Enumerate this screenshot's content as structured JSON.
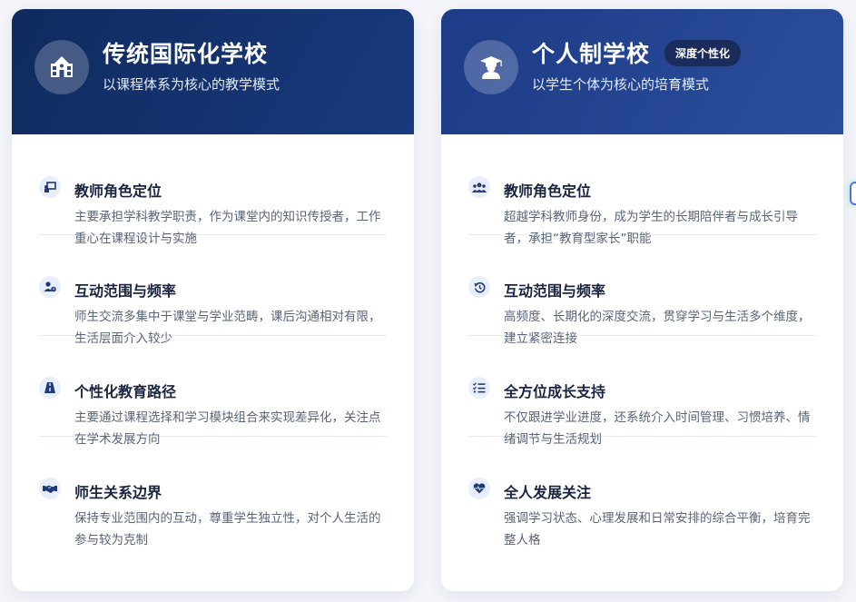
{
  "cards": [
    {
      "title": "传统国际化学校",
      "subtitle": "以课程体系为核心的教学模式",
      "icon": "school-icon",
      "items": [
        {
          "title": "教师角色定位",
          "desc": "主要承担学科教学职责，作为课堂内的知识传授者，工作重心在课程设计与实施",
          "icon": "chalkboard-teacher-icon"
        },
        {
          "title": "互动范围与频率",
          "desc": "师生交流多集中于课堂与学业范畴，课后沟通相对有限，生活层面介入较少",
          "icon": "user-clock-icon"
        },
        {
          "title": "个性化教育路径",
          "desc": "主要通过课程选择和学习模块组合来实现差异化，关注点在学术发展方向",
          "icon": "road-icon"
        },
        {
          "title": "师生关系边界",
          "desc": "保持专业范围内的互动，尊重学生独立性，对个人生活的参与较为克制",
          "icon": "handshake-icon"
        }
      ]
    },
    {
      "title": "个人制学校",
      "badge": "深度个性化",
      "subtitle": "以学生个体为核心的培育模式",
      "icon": "graduate-icon",
      "items": [
        {
          "title": "教师角色定位",
          "desc": "超越学科教师身份，成为学生的长期陪伴者与成长引导者，承担“教育型家长”职能",
          "icon": "users-icon"
        },
        {
          "title": "互动范围与频率",
          "desc": "高频度、长期化的深度交流，贯穿学习与生活多个维度，建立紧密连接",
          "icon": "history-icon"
        },
        {
          "title": "全方位成长支持",
          "desc": "不仅跟进学业进度，还系统介入时间管理、习惯培养、情绪调节与生活规划",
          "icon": "checklist-icon"
        },
        {
          "title": "全人发展关注",
          "desc": "强调学习状态、心理发展和日常安排的综合平衡，培育完整人格",
          "icon": "heart-pulse-icon"
        }
      ]
    }
  ]
}
